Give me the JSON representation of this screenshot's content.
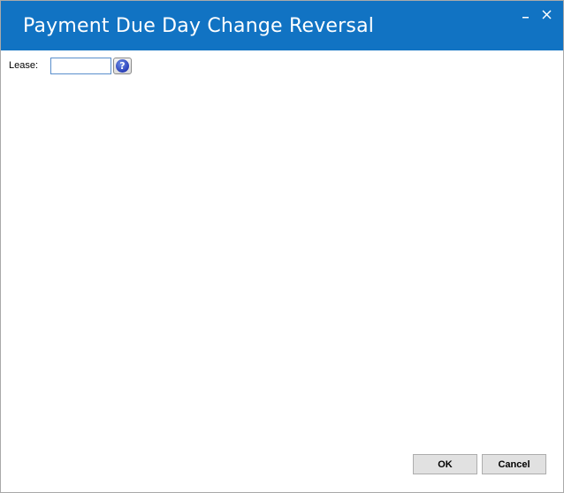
{
  "window": {
    "title": "Payment Due Day Change Reversal",
    "minimize_glyph": "_",
    "close_glyph": "×"
  },
  "form": {
    "lease_label": "Lease:",
    "lease_value": "",
    "help_glyph": "?"
  },
  "buttons": {
    "ok_label": "OK",
    "cancel_label": "Cancel"
  },
  "colors": {
    "titlebar": "#1173c3",
    "title_text": "#ffffff"
  },
  "icons": {
    "minimize": "minimize-icon",
    "close": "close-icon",
    "help": "help-icon"
  }
}
